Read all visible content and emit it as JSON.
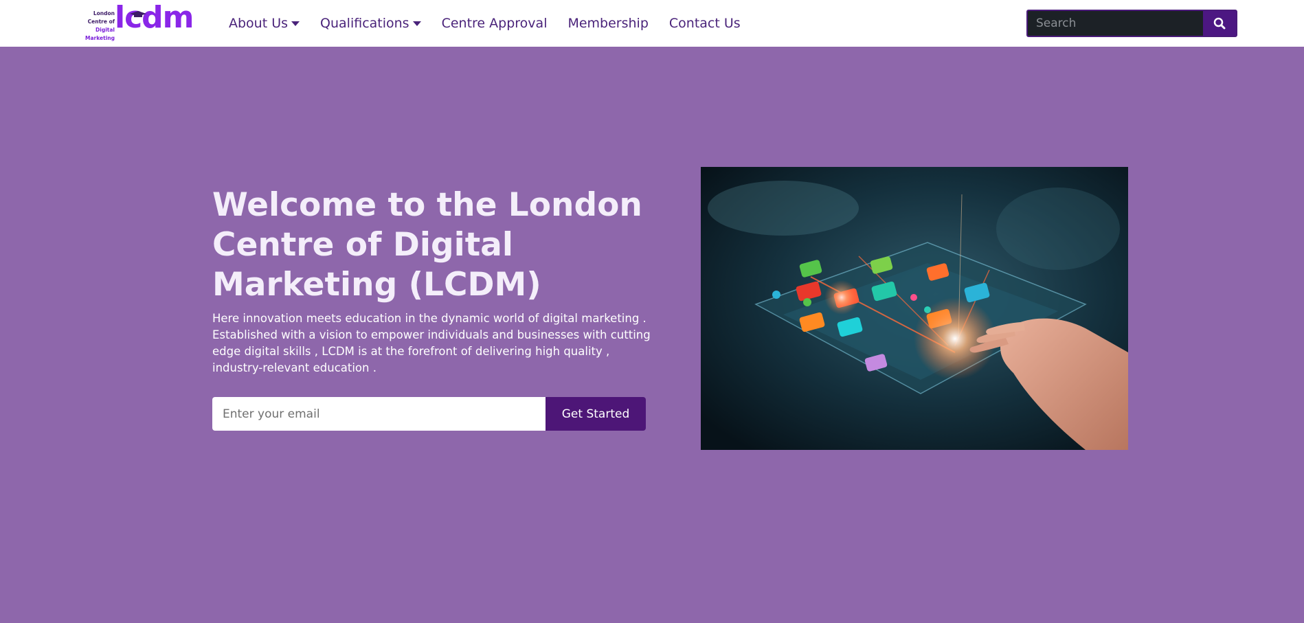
{
  "header": {
    "logo": {
      "line1": "London",
      "line2": "Centre of",
      "line3": "Digital Marketing",
      "brand": "lcdm"
    },
    "nav": [
      {
        "label": "About Us",
        "dropdown": true
      },
      {
        "label": "Qualifications",
        "dropdown": true
      },
      {
        "label": "Centre Approval",
        "dropdown": false
      },
      {
        "label": "Membership",
        "dropdown": false
      },
      {
        "label": "Contact Us",
        "dropdown": false
      }
    ],
    "search": {
      "placeholder": "Search",
      "icon": "search-icon"
    }
  },
  "hero": {
    "title": "Welcome to the London Centre of Digital Marketing (LCDM)",
    "text": "Here innovation meets education in the dynamic world of digital marketing . Established with a vision to empower individuals and businesses with cutting edge digital skills , LCDM is at the forefront of delivering high quality , industry-relevant education .",
    "email_placeholder": "Enter your email",
    "button_label": "Get Started"
  },
  "colors": {
    "page_background": "#8e67ab",
    "header_background": "#ffffff",
    "nav_text": "#4a237a",
    "accent": "#4d1677",
    "logo_purple": "#8a26e8"
  }
}
